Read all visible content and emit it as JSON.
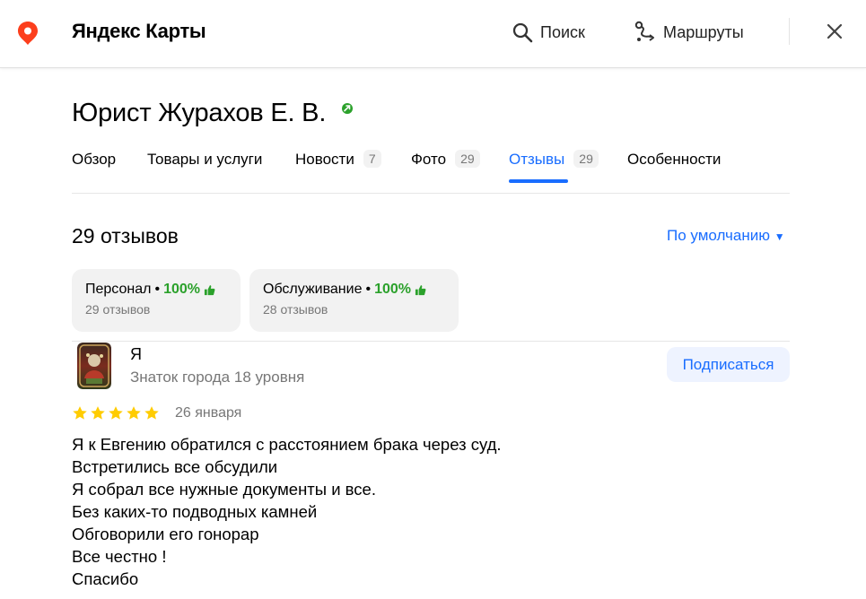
{
  "header": {
    "brand": "Яндекс Карты",
    "search_label": "Поиск",
    "routes_label": "Маршруты",
    "accent_color": "#196dff",
    "pin_color": "#fc3f1d"
  },
  "org": {
    "title": "Юрист Журахов Е. В."
  },
  "tabs": [
    {
      "label": "Обзор",
      "count": ""
    },
    {
      "label": "Товары и услуги",
      "count": ""
    },
    {
      "label": "Новости",
      "count": "7"
    },
    {
      "label": "Фото",
      "count": "29"
    },
    {
      "label": "Отзывы",
      "count": "29",
      "active": true
    },
    {
      "label": "Особенности",
      "count": ""
    }
  ],
  "reviews": {
    "total_label": "29 отзывов",
    "sort_label": "По умолчанию",
    "aspects": [
      {
        "name": "Персонал",
        "percent": "100%",
        "sub": "29 отзывов"
      },
      {
        "name": "Обслуживание",
        "percent": "100%",
        "sub": "28 отзывов"
      }
    ],
    "items": [
      {
        "author": "Я",
        "level": "Знаток города 18 уровня",
        "subscribe_label": "Подписаться",
        "rating": 5,
        "date": "26 января",
        "lines": [
          "Я к Евгению обратился с расстоянием брака через суд.",
          "Встретились все обсудили",
          "Я собрал все нужные документы и все.",
          "Без каких-то подводных камней",
          "Обговорили его гонорар",
          "Все честно !",
          "Спасибо"
        ]
      }
    ]
  }
}
